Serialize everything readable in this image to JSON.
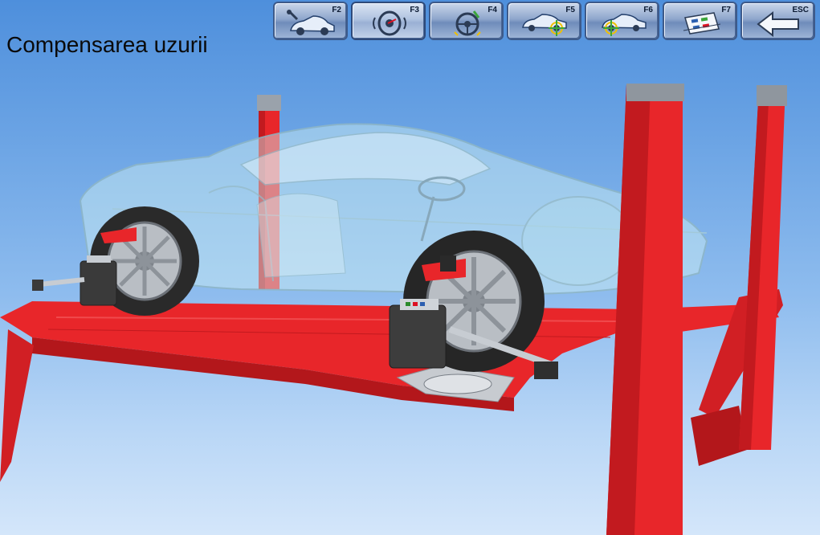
{
  "page": {
    "title": "Compensarea uzurii"
  },
  "toolbar": {
    "buttons": [
      {
        "key": "F2",
        "icon": "car-with-tool-icon"
      },
      {
        "key": "F3",
        "icon": "wheel-compensation-icon",
        "active": true
      },
      {
        "key": "F4",
        "icon": "steering-wheel-level-icon"
      },
      {
        "key": "F5",
        "icon": "car-front-axle-adjust-icon"
      },
      {
        "key": "F6",
        "icon": "car-rear-axle-adjust-icon"
      },
      {
        "key": "F7",
        "icon": "printout-report-icon"
      },
      {
        "key": "ESC",
        "icon": "back-arrow-icon"
      }
    ]
  },
  "colors": {
    "background_top": "#4e8fdc",
    "background_bottom": "#d4e6fa",
    "lift_red": "#e8262a",
    "lift_dark_red": "#a81418",
    "car_glass": "#bfe6ee",
    "button_frame": "#3d5a8a"
  }
}
